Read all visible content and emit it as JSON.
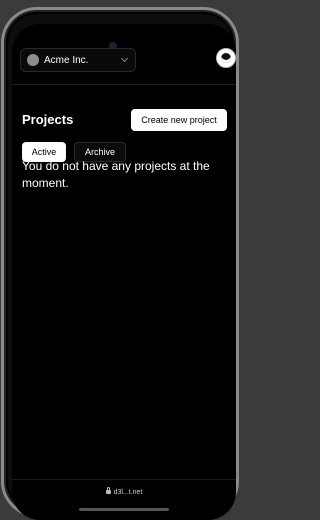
{
  "header": {
    "org_name": "Acme Inc.",
    "org_logo": "org-avatar-icon",
    "avatar": "user-avatar-icon"
  },
  "page": {
    "title": "Projects",
    "create_label": "Create new project"
  },
  "tabs": [
    {
      "label": "Active",
      "selected": true
    },
    {
      "label": "Archive",
      "selected": false
    }
  ],
  "empty_state": {
    "message": "You do not have any projects at the moment."
  },
  "browser": {
    "url": "d3l...t.net"
  },
  "colors": {
    "background": "#000000",
    "primary_button": "#ffffff"
  }
}
